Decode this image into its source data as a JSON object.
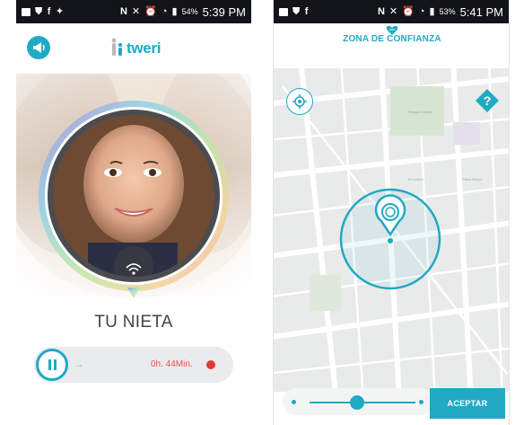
{
  "left_screen": {
    "status_bar": {
      "left_icons": [
        "chat-icon",
        "shield-icon",
        "facebook-icon",
        "twitter-icon"
      ],
      "right_icons": [
        "nfc-icon",
        "mute-icon",
        "alarm-icon",
        "wifi-icon",
        "signal-icon"
      ],
      "battery": "54%",
      "time": "5:39 PM"
    },
    "app_bar": {
      "logo_text": "tweri",
      "megaphone_icon": "megaphone-icon"
    },
    "contact": {
      "name": "TU NIETA",
      "wifi_icon": "wifi-icon"
    },
    "player": {
      "duration": "0h. 44Min.",
      "pause_icon": "pause-icon",
      "arrow_icon": "arrow-icon",
      "record_icon": "record-dot-icon"
    }
  },
  "right_screen": {
    "status_bar": {
      "left_icons": [
        "chat-icon",
        "shield-icon",
        "facebook-icon"
      ],
      "right_icons": [
        "nfc-icon",
        "mute-icon",
        "alarm-icon",
        "wifi-icon",
        "signal-icon"
      ],
      "battery": "53%",
      "time": "5:41 PM"
    },
    "header": {
      "title": "ZONA DE CONFIANZA",
      "heart_icon": "heart-chat-icon"
    },
    "map": {
      "locate_icon": "locate-icon",
      "help_icon": "help-icon",
      "pin_icon": "location-pin-icon",
      "map_labels": [
        "Parque Central",
        "El Carrito",
        "Plaza Mayor"
      ]
    },
    "radius_slider": {
      "level": 0.45
    },
    "accept_button": {
      "label": "ACEPTAR"
    }
  },
  "colors": {
    "accent": "#22a9c4",
    "record": "#e23a3a",
    "duration_text": "#e0564f",
    "name_text": "#3e4448"
  }
}
